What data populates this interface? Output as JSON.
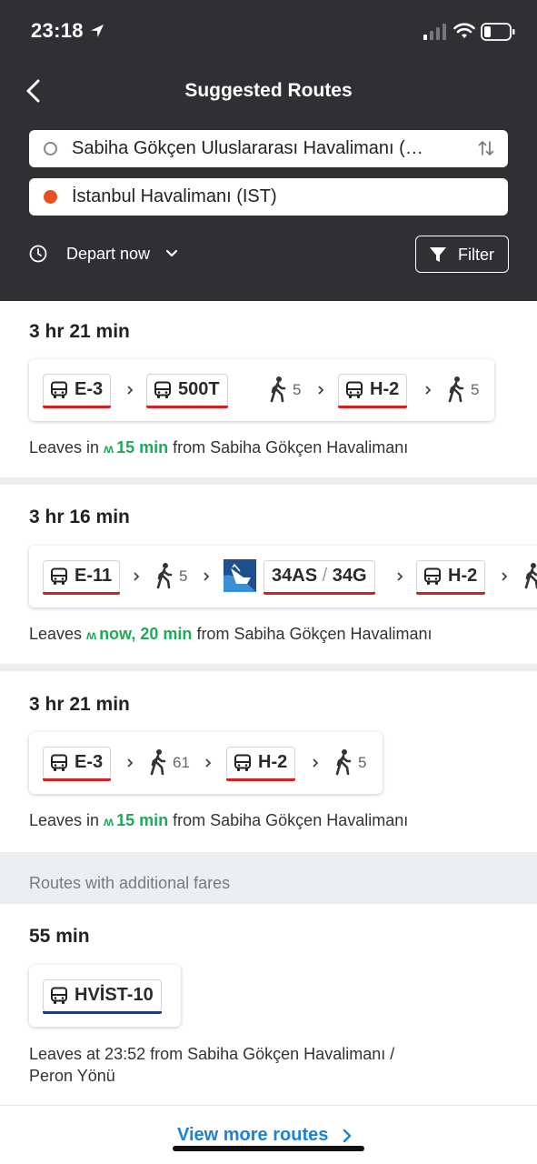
{
  "status_bar": {
    "time": "23:18"
  },
  "header": {
    "title": "Suggested Routes",
    "origin": "Sabiha Gökçen Uluslararası Havalimanı (…",
    "destination": "İstanbul Havalimanı (IST)",
    "depart": "Depart now",
    "filter": "Filter"
  },
  "routes": [
    {
      "duration": "3 hr 21 min",
      "legs": {
        "l1": "E-3",
        "l2": "500T",
        "w1": "5",
        "l3": "H-2",
        "w2": "5"
      },
      "leaves_prefix": "Leaves in",
      "leaves_time": "15 min",
      "leaves_suffix": "from Sabiha Gökçen Havalimanı"
    },
    {
      "duration": "3 hr 16 min",
      "legs": {
        "l1": "E-11",
        "w1": "5",
        "l2a": "34AS",
        "l2b": "34G",
        "l3": "H-2"
      },
      "leaves_prefix": "Leaves",
      "leaves_time": "now, 20 min",
      "leaves_suffix": "from Sabiha Gökçen Havalimanı"
    },
    {
      "duration": "3 hr 21 min",
      "legs": {
        "l1": "E-3",
        "w1": "61",
        "l2": "H-2",
        "w2": "5"
      },
      "leaves_prefix": "Leaves in",
      "leaves_time": "15 min",
      "leaves_suffix": "from Sabiha Gökçen Havalimanı"
    }
  ],
  "additional_fares": {
    "heading": "Routes with additional fares",
    "duration": "55 min",
    "line": "HVİST-10",
    "leaves_line1": "Leaves at 23:52 from Sabiha Gökçen Havalimanı /",
    "leaves_line2": "Peron Yönü"
  },
  "view_more": "View more routes",
  "colors": {
    "header_bg": "#2f3034",
    "line_red": "#d62020",
    "line_navy": "#1e3c7a",
    "live_green": "#1eaa5a",
    "link_blue": "#1b82d8",
    "origin_dot": "#e8501f"
  }
}
